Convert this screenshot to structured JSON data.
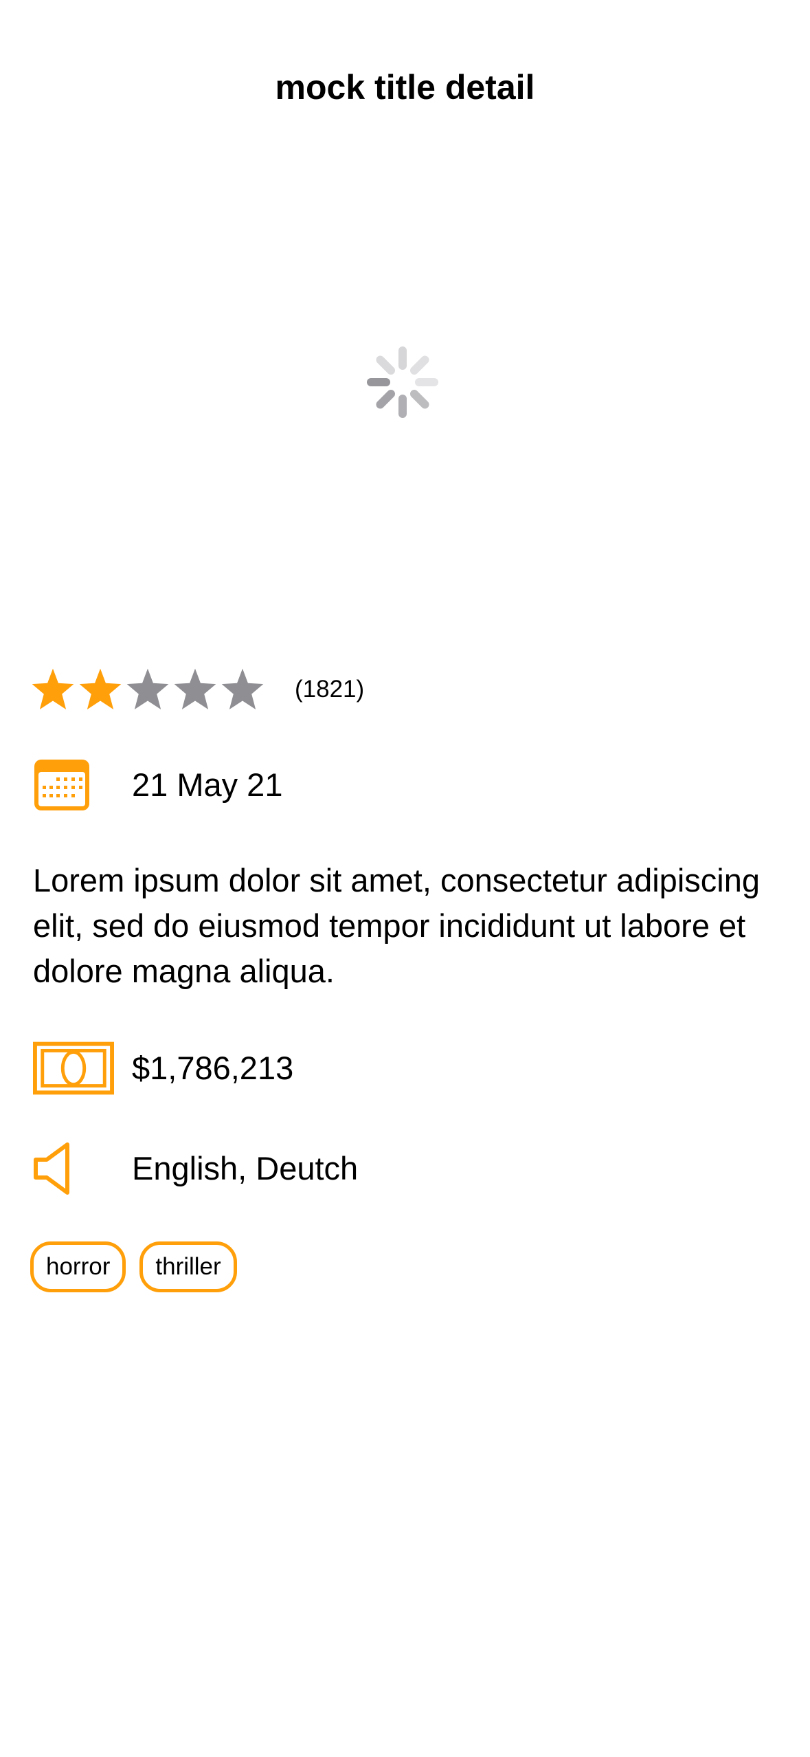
{
  "colors": {
    "accent": "#FF9F0A",
    "star_empty": "#8E8E93",
    "text": "#000000",
    "background": "#FFFFFF"
  },
  "nav": {
    "title": "mock title detail"
  },
  "poster": {
    "state": "loading",
    "icon": "activity-spinner-icon"
  },
  "rating": {
    "filled_stars": 2,
    "total_stars": 5,
    "count": "(1821)"
  },
  "release": {
    "icon": "calendar-icon",
    "date": "21 May 21"
  },
  "overview": "Lorem ipsum dolor sit amet, consectetur adipiscing elit, sed do eiusmod tempor incididunt ut labore et dolore magna aliqua.",
  "budget": {
    "icon": "banknote-icon",
    "value": "$1,786,213"
  },
  "languages": {
    "icon": "speaker-icon",
    "value": "English, Deutch"
  },
  "genres": [
    "horror",
    "thriller"
  ]
}
